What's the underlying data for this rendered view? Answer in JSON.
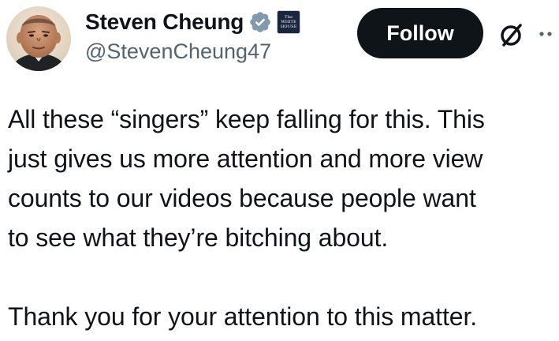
{
  "author": {
    "display_name": "Steven Cheung",
    "handle": "@StevenCheung47",
    "verified_badge_color": "#829aab",
    "affiliation_badge": {
      "icon": "white-house-badge-icon",
      "lines": [
        "The",
        "WHITE",
        "HOUSE"
      ]
    }
  },
  "actions": {
    "follow_label": "Follow",
    "grok_icon": "grok-slash-icon",
    "more_icon": "more-dots-icon"
  },
  "tweet": {
    "lines": [
      "All these “singers” keep falling for this. This",
      "just gives us more attention and more view",
      "counts to our videos because people want",
      "to see what they’re bitching about.",
      "",
      "Thank you for your attention to this matter."
    ]
  },
  "colors": {
    "text_primary": "#0f1419",
    "text_secondary": "#536471",
    "button_bg": "#0f1419",
    "button_text": "#ffffff"
  }
}
